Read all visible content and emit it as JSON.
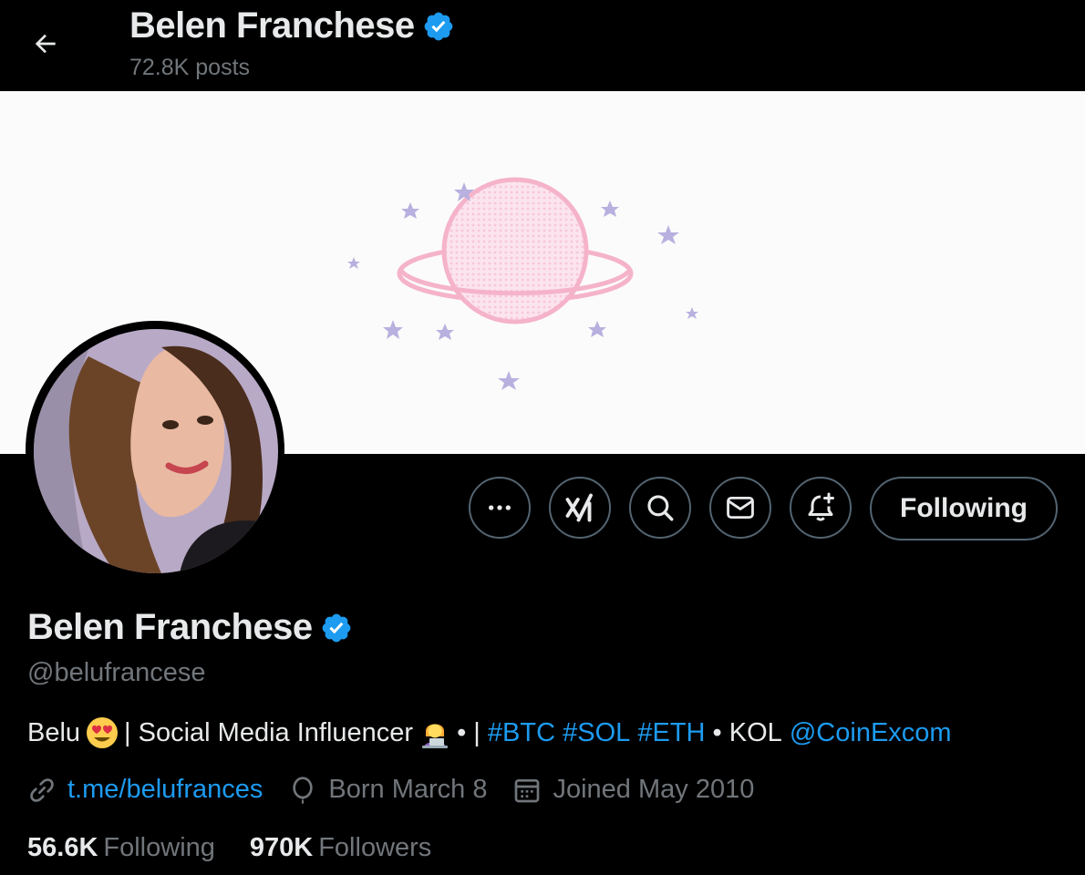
{
  "header": {
    "name": "Belen Franchese",
    "posts": "72.8K posts"
  },
  "profile": {
    "name": "Belen Franchese",
    "handle": "@belufrancese",
    "bio": {
      "part1": "Belu",
      "part2": "| Social Media Influencer",
      "part3": "• |",
      "tag1": "#BTC",
      "tag2": "#SOL",
      "tag3": "#ETH",
      "part4": "• KOL",
      "mention": "@CoinExcom"
    },
    "link": "t.me/belufrances",
    "born": "Born March 8",
    "joined": "Joined May 2010",
    "following_count": "56.6K",
    "following_label": "Following",
    "followers_count": "970K",
    "followers_label": "Followers"
  },
  "actions": {
    "follow_label": "Following"
  },
  "colors": {
    "accent": "#1d9bf0",
    "muted": "#71767b",
    "text": "#e7e9ea",
    "border": "#536471",
    "background": "#000000"
  },
  "icons": [
    "back-arrow-icon",
    "verified-badge-icon",
    "more-icon",
    "grok-icon",
    "search-icon",
    "message-icon",
    "notification-bell-icon",
    "link-icon",
    "balloon-icon",
    "calendar-icon"
  ]
}
